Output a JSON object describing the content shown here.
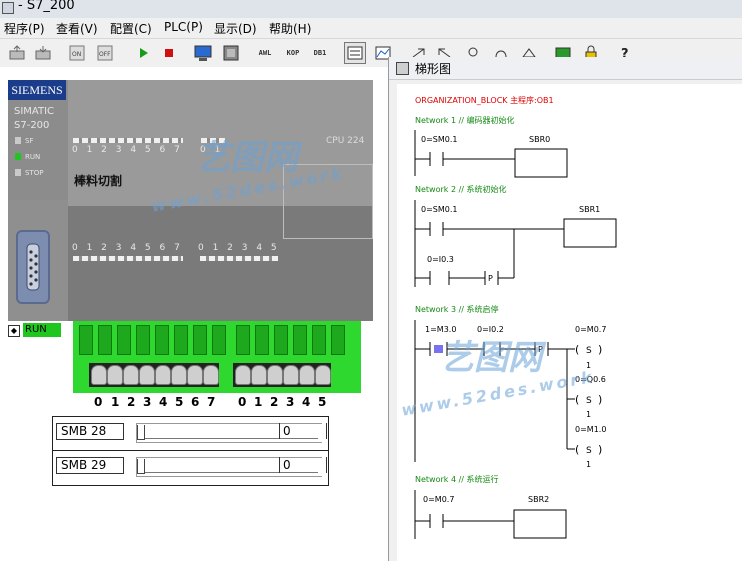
{
  "window": {
    "title": "- S7_200"
  },
  "menubar": {
    "items": [
      "程序(P)",
      "查看(V)",
      "配置(C)",
      "PLC(P)",
      "显示(D)",
      "帮助(H)"
    ]
  },
  "toolbar": {
    "awl_label": "AWL",
    "kop_label": "KOP",
    "db1_label": "DB1"
  },
  "plc": {
    "brand": "SIEMENS",
    "model_line1": "SIMATIC",
    "model_line2": "S7-200",
    "leds": [
      "SF",
      "RUN",
      "STOP"
    ],
    "cpu_label": "CPU 224",
    "project_label": "棒料切割",
    "input_digits_a": "0 1 2 3 4 5 6 7",
    "input_digits_b": "0 1",
    "output_digits_a": "0 1 2 3 4 5 6 7",
    "output_digits_b": "0 1 2 3 4 5",
    "run_label": "RUN"
  },
  "switch_labels": [
    "0",
    "1",
    "2",
    "3",
    "4",
    "5",
    "6",
    "7",
    "0",
    "1",
    "2",
    "3",
    "4",
    "5"
  ],
  "smb": [
    {
      "name": "SMB 28",
      "value": "0",
      "slider_level": 0
    },
    {
      "name": "SMB 29",
      "value": "0",
      "slider_level": 0
    }
  ],
  "ladder": {
    "window_title": "梯形图",
    "org_block": "ORGANIZATION_BLOCK 主程序:OB1",
    "networks": [
      {
        "title": "Network 1 // 编码器初始化",
        "contacts": [
          "0=SM0.1"
        ],
        "boxes": [
          "SBR0"
        ]
      },
      {
        "title": "Network 2 // 系统初始化",
        "contacts": [
          "0=SM0.1",
          "0=I0.3",
          "P"
        ],
        "boxes": [
          "SBR1"
        ]
      },
      {
        "title": "Network 3 // 系统启停",
        "contacts": [
          "1=M3.0",
          "0=I0.2",
          "P"
        ],
        "coils": [
          {
            "name": "0=M0.7",
            "type": "S",
            "count": "1"
          },
          {
            "name": "0=Q0.6",
            "type": "S",
            "count": "1"
          },
          {
            "name": "0=M1.0",
            "type": "S",
            "count": "1"
          }
        ]
      },
      {
        "title": "Network 4 // 系统运行",
        "contacts": [
          "0=M0.7"
        ],
        "boxes": [
          "SBR2"
        ]
      }
    ]
  },
  "watermark": {
    "text1": "艺图网",
    "text2": "www.52des.work"
  },
  "colors": {
    "plc_body": "#8c8c8c",
    "switch_green": "#2ed82e",
    "run_green": "#1ec61e",
    "ladder_red": "#e00000",
    "ladder_green": "#148a14",
    "siemens_blue": "#1b3c8a"
  }
}
